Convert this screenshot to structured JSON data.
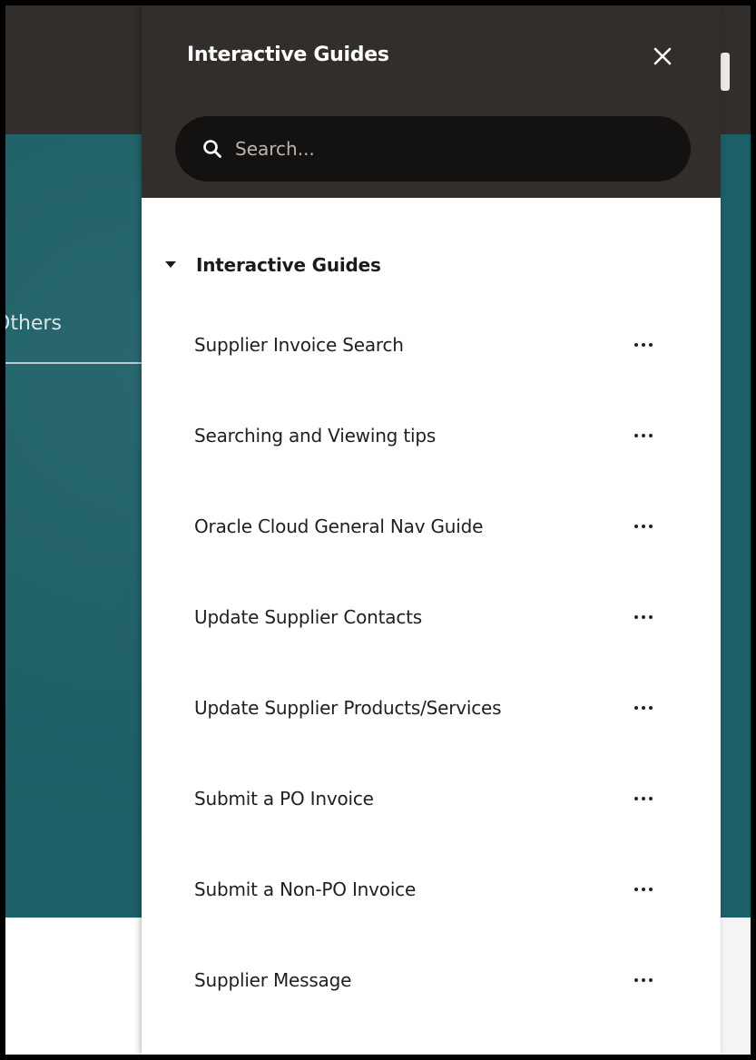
{
  "background": {
    "tab_partial_label": "Others"
  },
  "panel": {
    "title": "Interactive Guides",
    "close_icon": "close-icon",
    "search": {
      "placeholder": "Search..."
    },
    "section": {
      "label": "Interactive Guides",
      "expanded": true
    },
    "items": [
      {
        "label": "Supplier Invoice Search"
      },
      {
        "label": "Searching and Viewing tips"
      },
      {
        "label": "Oracle Cloud General Nav Guide"
      },
      {
        "label": "Update Supplier Contacts"
      },
      {
        "label": "Update Supplier Products/Services"
      },
      {
        "label": "Submit a PO Invoice"
      },
      {
        "label": "Submit a Non-PO Invoice"
      },
      {
        "label": "Supplier Message"
      }
    ]
  },
  "colors": {
    "header_bg": "#322e2b",
    "search_bg": "#141211",
    "teal": "#1d5f66"
  }
}
